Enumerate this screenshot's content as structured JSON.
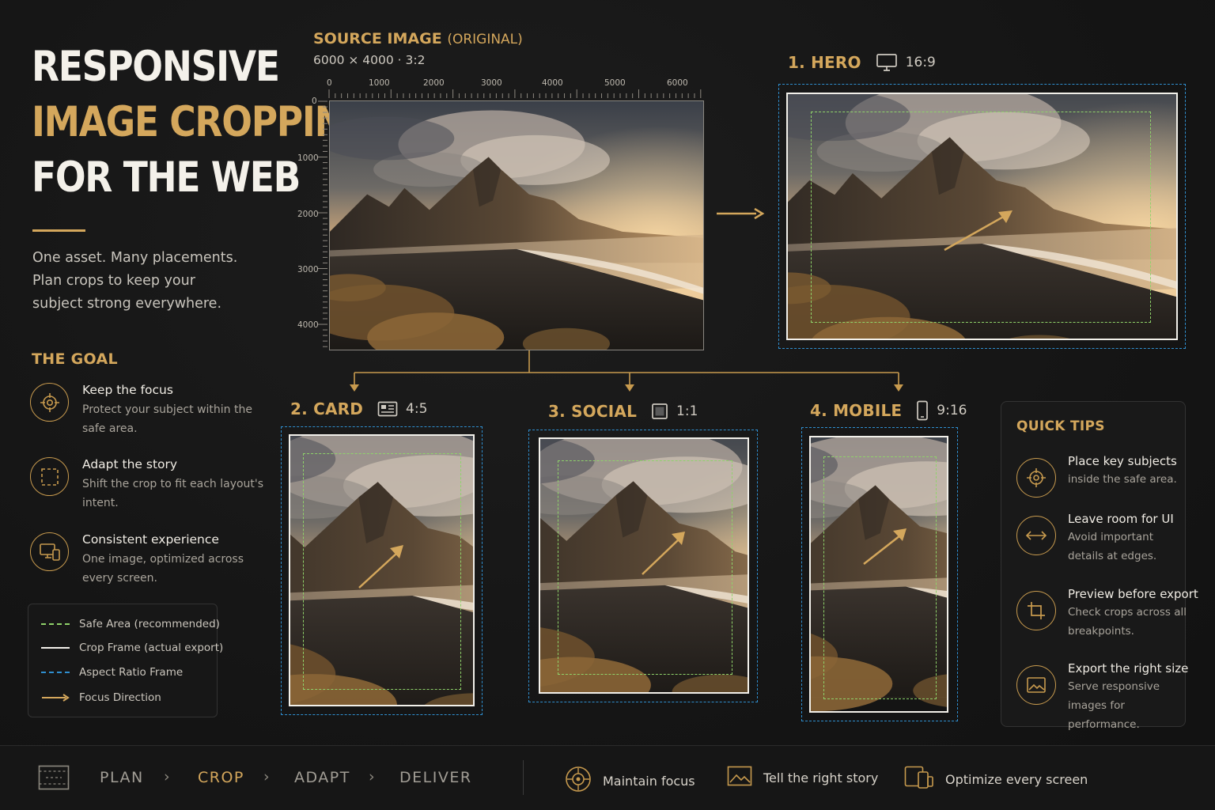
{
  "title": {
    "line1": "RESPONSIVE",
    "line2": "IMAGE CROPPING",
    "line3": "FOR THE WEB"
  },
  "intro": {
    "line1": "One asset. Many placements.",
    "line2": "Plan crops to keep your",
    "line3": "subject strong everywhere."
  },
  "goal": {
    "heading": "THE GOAL",
    "items": [
      {
        "title": "Keep the focus",
        "desc": "Protect your subject within the safe area.",
        "icon": "target-icon"
      },
      {
        "title": "Adapt the story",
        "desc": "Shift the crop to fit each layout's intent.",
        "icon": "dashed-frame-icon"
      },
      {
        "title": "Consistent experience",
        "desc": "One image, optimized across every screen.",
        "icon": "devices-icon"
      }
    ]
  },
  "legend": {
    "items": [
      {
        "label": "Safe Area (recommended)",
        "color": "#8fd36a",
        "style": "dashed"
      },
      {
        "label": "Crop Frame (actual export)",
        "color": "#f2f0ea",
        "style": "solid"
      },
      {
        "label": "Aspect Ratio Frame",
        "color": "#2f8fd0",
        "style": "dashed"
      },
      {
        "label": "Focus Direction",
        "color": "#d4a75c",
        "style": "arrow"
      }
    ]
  },
  "source": {
    "title": "SOURCE IMAGE",
    "subtitle": "(ORIGINAL)",
    "dims": "6000 × 4000  ·  3:2",
    "ruler_x": [
      "0",
      "1000",
      "2000",
      "3000",
      "4000",
      "5000",
      "6000"
    ],
    "ruler_y": [
      "0",
      "1000",
      "2000",
      "3000",
      "4000"
    ]
  },
  "variants": {
    "hero": {
      "name": "1. HERO",
      "ratio": "16:9",
      "icon": "monitor-icon"
    },
    "card": {
      "name": "2. CARD",
      "ratio": "4:5",
      "icon": "card-icon"
    },
    "social": {
      "name": "3. SOCIAL",
      "ratio": "1:1",
      "icon": "square-icon"
    },
    "mobile": {
      "name": "4. MOBILE",
      "ratio": "9:16",
      "icon": "phone-icon"
    }
  },
  "tips": {
    "heading": "QUICK TIPS",
    "items": [
      {
        "title": "Place key subjects",
        "desc": "inside the safe area.",
        "icon": "target-icon"
      },
      {
        "title": "Leave room for UI",
        "desc": "Avoid important details at edges.",
        "icon": "horizontal-arrows-icon"
      },
      {
        "title": "Preview before export",
        "desc": "Check crops across all breakpoints.",
        "icon": "crop-icon"
      },
      {
        "title": "Export the right size",
        "desc": "Serve responsive images for performance.",
        "icon": "image-icon"
      }
    ]
  },
  "workflow": {
    "steps": [
      "PLAN",
      "CROP",
      "ADAPT",
      "DELIVER"
    ],
    "active": "CROP",
    "features": [
      {
        "label": "Maintain focus",
        "icon": "target-icon"
      },
      {
        "label": "Tell the right story",
        "icon": "landscape-icon"
      },
      {
        "label": "Optimize every screen",
        "icon": "devices-icon"
      }
    ]
  },
  "colors": {
    "accent": "#d4a75c",
    "safe_area": "#8fd36a",
    "crop_frame": "#f2f0ea",
    "aspect_frame": "#2f8fd0",
    "background": "#141414"
  }
}
